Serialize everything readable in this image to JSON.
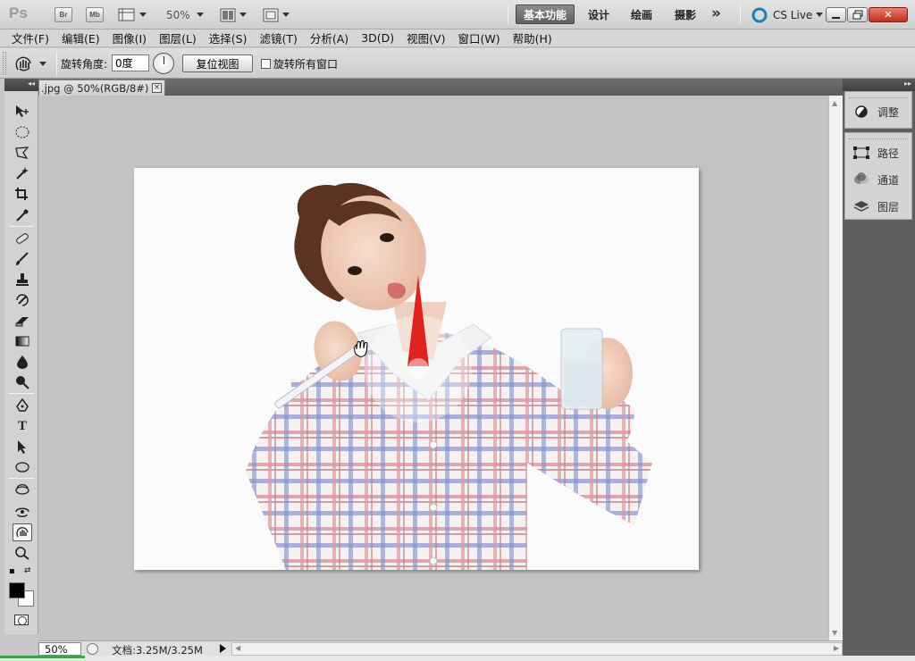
{
  "app": {
    "logo": "Ps",
    "bridge_btn": "Br",
    "minibridge_btn": "Mb",
    "zoom_level": "50%"
  },
  "workspaces": [
    {
      "label": "基本功能",
      "active": true
    },
    {
      "label": "设计",
      "active": false
    },
    {
      "label": "绘画",
      "active": false
    },
    {
      "label": "摄影",
      "active": false
    }
  ],
  "overflow_label": "»",
  "cs_live": "CS Live",
  "menu": [
    "文件(F)",
    "编辑(E)",
    "图像(I)",
    "图层(L)",
    "选择(S)",
    "滤镜(T)",
    "分析(A)",
    "3D(D)",
    "视图(V)",
    "窗口(W)",
    "帮助(H)"
  ],
  "options": {
    "rotate_label": "旋转角度:",
    "rotate_value": "0度",
    "reset_view": "复位视图",
    "rotate_all_windows": "旋转所有窗口",
    "rotate_all_checked": false
  },
  "document": {
    "tab_title": ".jpg @ 50%(RGB/8#)",
    "tab_close": "×"
  },
  "status": {
    "zoom": "50%",
    "doc_info": "文档:3.25M/3.25M"
  },
  "panels": [
    {
      "icon": "adjustments-icon",
      "label": "调整"
    },
    {
      "icon": "paths-icon",
      "label": "路径"
    },
    {
      "icon": "channels-icon",
      "label": "通道"
    },
    {
      "icon": "layers-icon",
      "label": "图层"
    }
  ],
  "colors": {
    "foreground": "#000000",
    "background": "#ffffff",
    "accent_rotate_indicator": "#e0221f"
  }
}
